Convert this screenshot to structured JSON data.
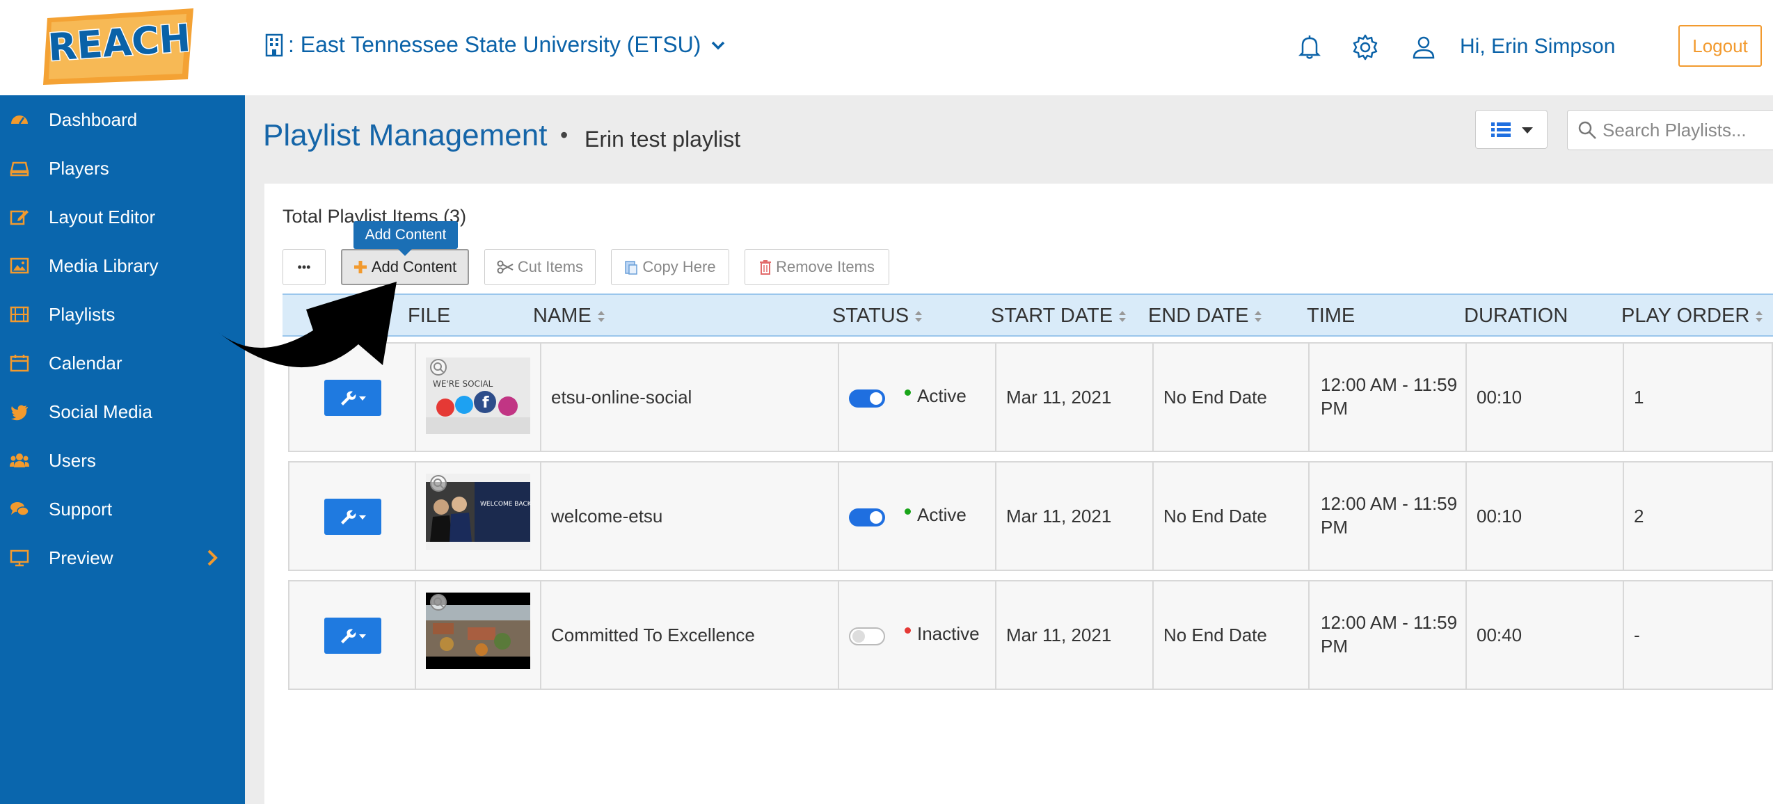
{
  "header": {
    "logo_text": "REACH",
    "organization": ": East Tennessee State University (ETSU)",
    "greeting": "Hi, Erin Simpson",
    "logout_label": "Logout",
    "icons": [
      "bell-icon",
      "gear-icon",
      "user-icon"
    ]
  },
  "sidebar": {
    "items": [
      {
        "label": "Dashboard",
        "icon": "dashboard-icon"
      },
      {
        "label": "Players",
        "icon": "player-icon"
      },
      {
        "label": "Layout Editor",
        "icon": "edit-icon"
      },
      {
        "label": "Media Library",
        "icon": "image-icon"
      },
      {
        "label": "Playlists",
        "icon": "film-icon"
      },
      {
        "label": "Calendar",
        "icon": "calendar-icon"
      },
      {
        "label": "Social Media",
        "icon": "twitter-icon"
      },
      {
        "label": "Users",
        "icon": "users-icon"
      },
      {
        "label": "Support",
        "icon": "chat-icon"
      },
      {
        "label": "Preview",
        "icon": "monitor-icon"
      }
    ]
  },
  "page": {
    "title": "Playlist Management",
    "separator": "•",
    "playlist_name": "Erin test playlist",
    "search_placeholder": "Search Playlists..."
  },
  "toolbar": {
    "total_label": "Total Playlist Items (3)",
    "more_label": "•••",
    "add_label": "Add Content",
    "tooltip": "Add Content",
    "cut_label": "Cut Items",
    "copy_label": "Copy Here",
    "remove_label": "Remove Items"
  },
  "table": {
    "columns": [
      "FILE",
      "NAME",
      "STATUS",
      "START DATE",
      "END DATE",
      "TIME",
      "DURATION",
      "PLAY ORDER"
    ],
    "rows": [
      {
        "name": "etsu-online-social",
        "active": true,
        "status": "Active",
        "start": "Mar 11, 2021",
        "end": "No End Date",
        "time_1": "12:00 AM - 11:59",
        "time_2": "PM",
        "duration": "00:10",
        "order": "1",
        "thumb_text": "WE'RE SOCIAL"
      },
      {
        "name": "welcome-etsu",
        "active": true,
        "status": "Active",
        "start": "Mar 11, 2021",
        "end": "No End Date",
        "time_1": "12:00 AM - 11:59",
        "time_2": "PM",
        "duration": "00:10",
        "order": "2",
        "thumb_text": "WELCOME BACK, ETSU"
      },
      {
        "name": "Committed To Excellence",
        "active": false,
        "status": "Inactive",
        "start": "Mar 11, 2021",
        "end": "No End Date",
        "time_1": "12:00 AM - 11:59",
        "time_2": "PM",
        "duration": "00:40",
        "order": "-",
        "thumb_text": ""
      }
    ]
  },
  "colors": {
    "brand_blue": "#0a66ad",
    "accent_orange": "#f29a2e",
    "active_green": "#1aa51a",
    "inactive_red": "#e53935",
    "toggle_blue": "#1f6fe0"
  }
}
